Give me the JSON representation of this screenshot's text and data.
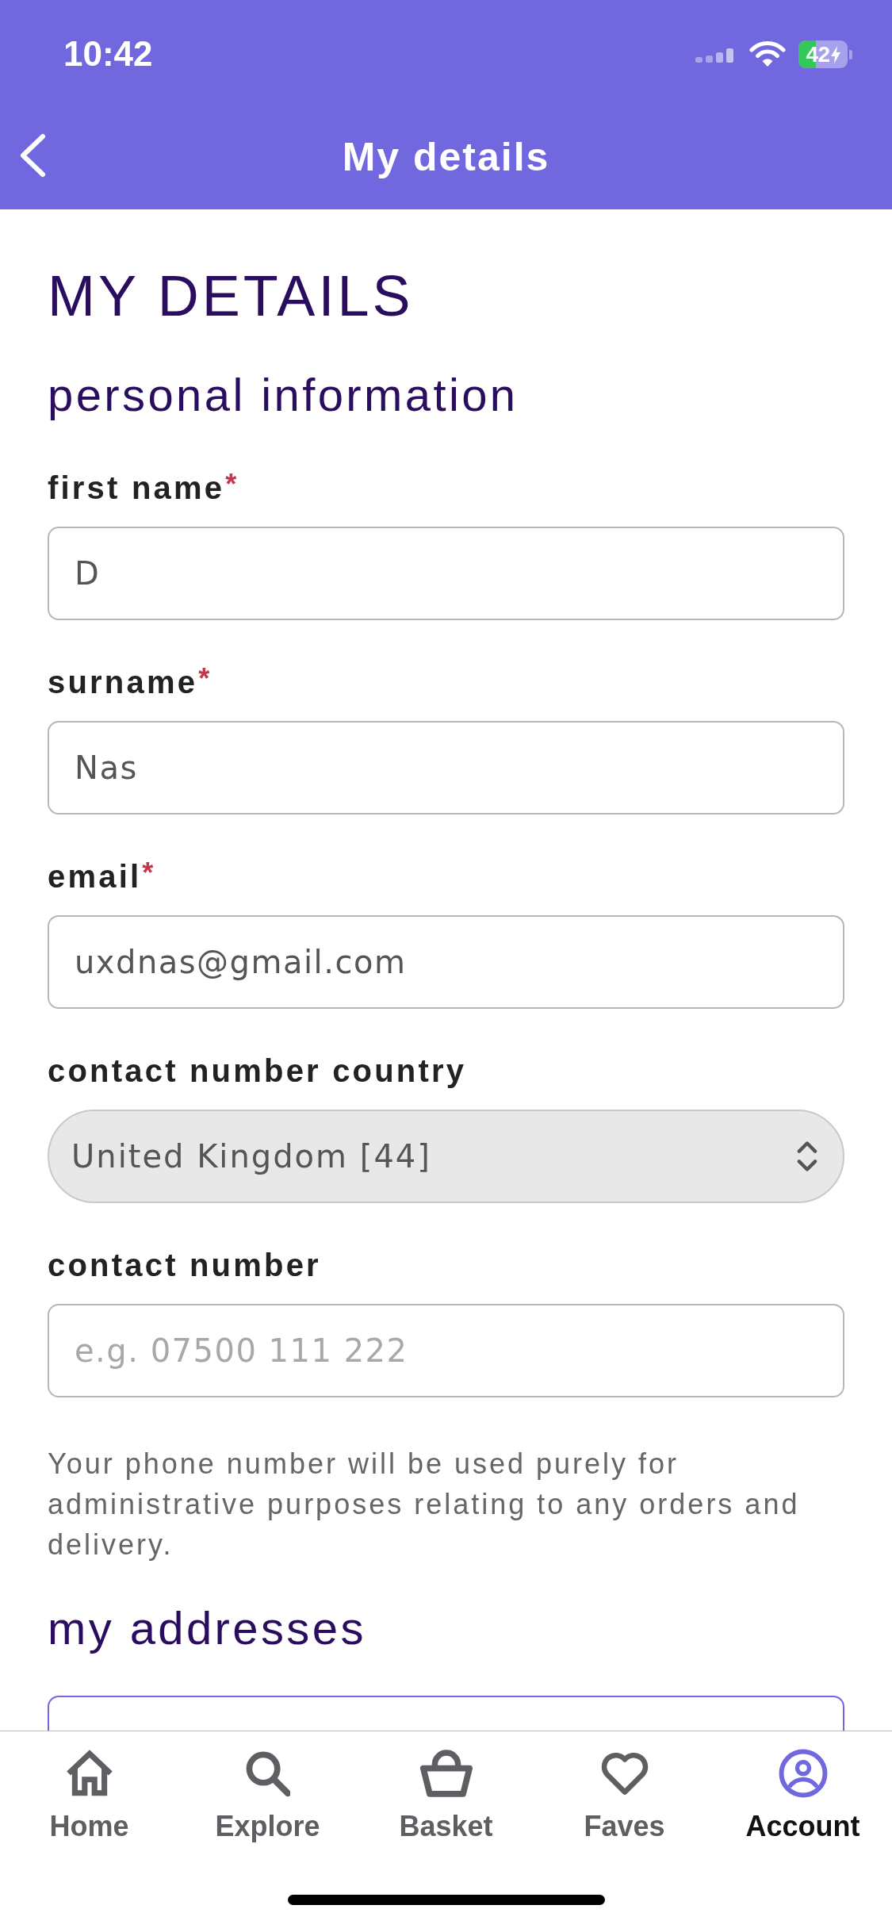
{
  "status_bar": {
    "time": "10:42",
    "battery": "42",
    "charging": true
  },
  "header": {
    "title": "My details"
  },
  "page_title": "MY DETAILS",
  "personal_information": {
    "heading": "personal information",
    "fields": [
      {
        "kind": "text",
        "label": "first name",
        "required_mark": "*",
        "value": "D"
      },
      {
        "kind": "text",
        "label": "surname",
        "required_mark": "*",
        "value": "Nas"
      },
      {
        "kind": "text",
        "label": "email",
        "required_mark": "*",
        "value": "uxdnas@gmail.com"
      },
      {
        "kind": "select",
        "label": "contact number country",
        "value": "United Kingdom [44]"
      },
      {
        "kind": "text",
        "label": "contact number",
        "placeholder": "e.g. 07500 111 222"
      }
    ],
    "note": "Your phone number will be used purely for administrative purposes relating to any orders and delivery."
  },
  "addresses": {
    "heading": "my addresses"
  },
  "tab_bar": [
    {
      "label": "Home",
      "selected": false
    },
    {
      "label": "Explore",
      "selected": false
    },
    {
      "label": "Basket",
      "selected": false
    },
    {
      "label": "Faves",
      "selected": false
    },
    {
      "label": "Account",
      "selected": true
    }
  ]
}
